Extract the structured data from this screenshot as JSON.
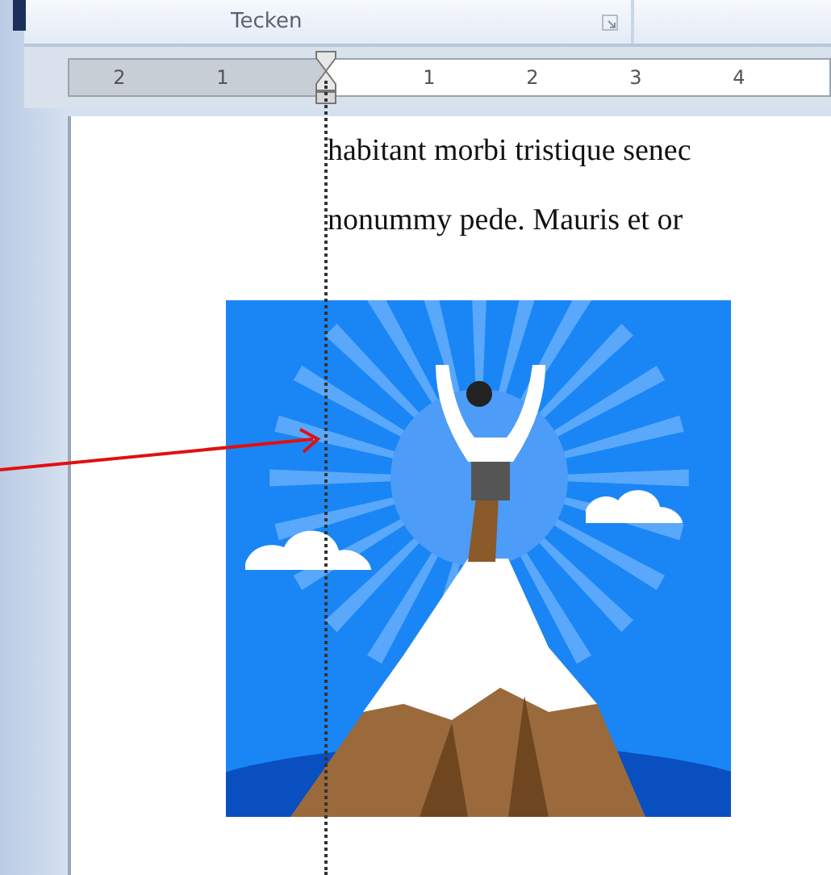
{
  "ribbon": {
    "group_label": "Tecken"
  },
  "ruler": {
    "left_labels": [
      "2",
      "1"
    ],
    "right_labels": [
      "1",
      "2",
      "3",
      "4"
    ]
  },
  "document": {
    "lines": [
      "habitant morbi tristique senec",
      "nonummy pede. Mauris et or"
    ]
  }
}
